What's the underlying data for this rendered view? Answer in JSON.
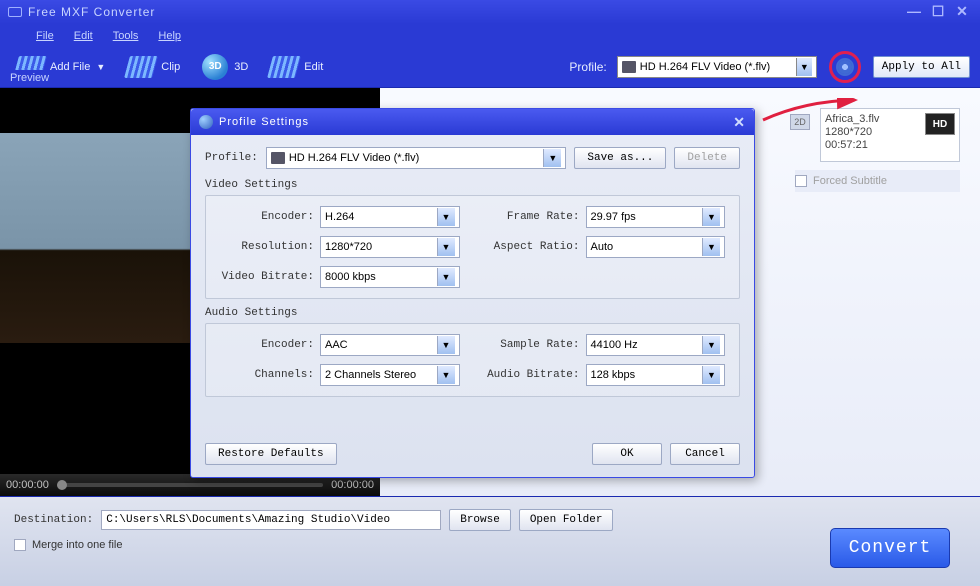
{
  "app": {
    "title": "Free MXF Converter"
  },
  "menu": {
    "file": "File",
    "edit": "Edit",
    "tools": "Tools",
    "help": "Help"
  },
  "toolbar": {
    "add_file": "Add File",
    "clip": "Clip",
    "three_d": "3D",
    "edit": "Edit",
    "profile_label": "Profile:",
    "profile_value": "HD H.264 FLV Video (*.flv)",
    "apply_all": "Apply to All"
  },
  "preview": {
    "label": "Preview",
    "time_left": "00:00:00",
    "time_right": "00:00:00"
  },
  "file_card": {
    "name": "Africa_3.flv",
    "resolution": "1280*720",
    "duration": "00:57:21",
    "hd": "HD",
    "badge_2d": "2D",
    "forced_subtitle": "Forced Subtitle"
  },
  "modal": {
    "title": "Profile Settings",
    "profile_label": "Profile:",
    "profile_value": "HD H.264 FLV Video (*.flv)",
    "save_as": "Save as...",
    "delete": "Delete",
    "video_settings_label": "Video Settings",
    "audio_settings_label": "Audio Settings",
    "video": {
      "encoder_label": "Encoder:",
      "encoder": "H.264",
      "resolution_label": "Resolution:",
      "resolution": "1280*720",
      "bitrate_label": "Video Bitrate:",
      "bitrate": "8000 kbps",
      "framerate_label": "Frame Rate:",
      "framerate": "29.97 fps",
      "aspect_label": "Aspect Ratio:",
      "aspect": "Auto"
    },
    "audio": {
      "encoder_label": "Encoder:",
      "encoder": "AAC",
      "channels_label": "Channels:",
      "channels": "2 Channels Stereo",
      "samplerate_label": "Sample Rate:",
      "samplerate": "44100 Hz",
      "bitrate_label": "Audio Bitrate:",
      "bitrate": "128 kbps"
    },
    "restore": "Restore Defaults",
    "ok": "OK",
    "cancel": "Cancel"
  },
  "dest": {
    "label": "Destination:",
    "path": "C:\\Users\\RLS\\Documents\\Amazing Studio\\Video",
    "browse": "Browse",
    "open_folder": "Open Folder",
    "merge": "Merge into one file",
    "convert": "Convert"
  }
}
